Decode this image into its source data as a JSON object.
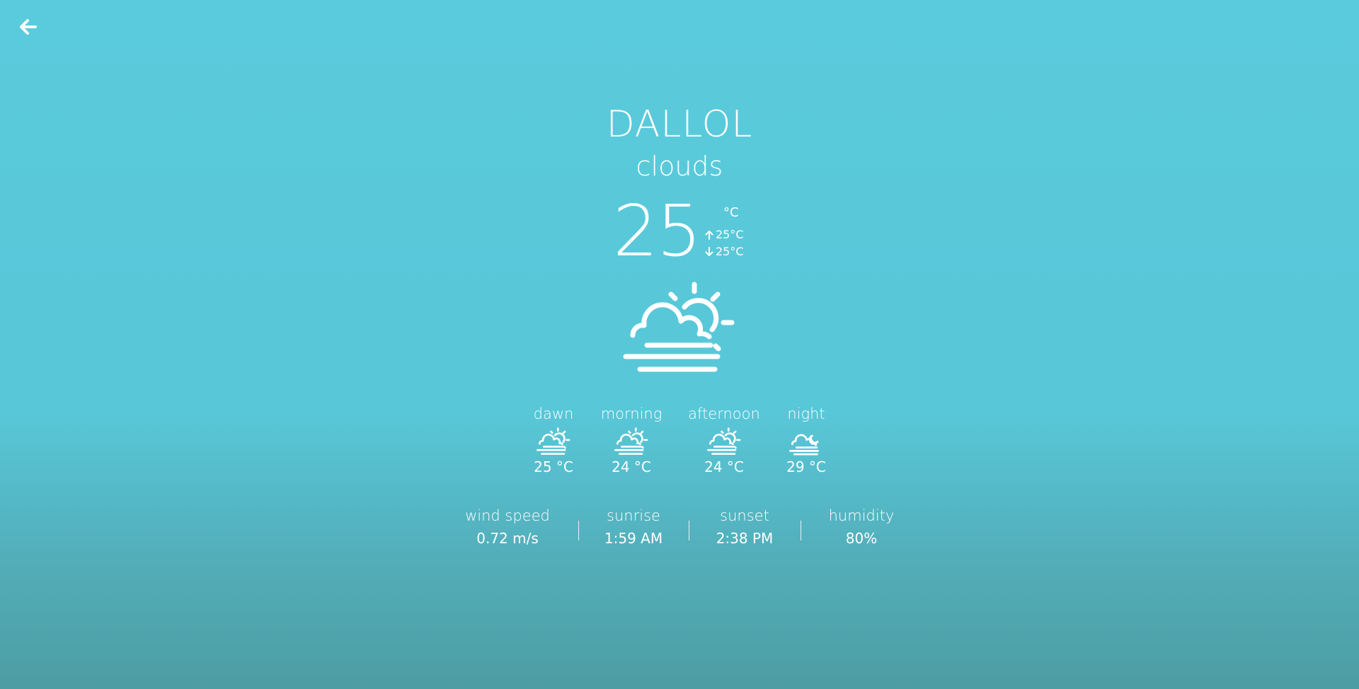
{
  "nav": {
    "back_icon": "arrow-left-icon"
  },
  "weather": {
    "city": "DALLOL",
    "condition": "clouds",
    "temperature": "25",
    "unit": "°C",
    "max": "25°C",
    "min": "25°C",
    "icon": "cloud-sun-fog-icon"
  },
  "periods": [
    {
      "label": "dawn",
      "temp": "25 °C",
      "icon": "cloud-sun-fog-icon"
    },
    {
      "label": "morning",
      "temp": "24 °C",
      "icon": "cloud-sun-fog-icon"
    },
    {
      "label": "afternoon",
      "temp": "24 °C",
      "icon": "cloud-sun-fog-icon"
    },
    {
      "label": "night",
      "temp": "29 °C",
      "icon": "cloud-moon-fog-icon"
    }
  ],
  "stats": [
    {
      "label": "wind speed",
      "value": "0.72 m/s"
    },
    {
      "label": "sunrise",
      "value": "1:59 AM"
    },
    {
      "label": "sunset",
      "value": "2:38 PM"
    },
    {
      "label": "humidity",
      "value": "80%"
    }
  ],
  "colors": {
    "text": "#ffffff",
    "background_top": "#5acbdc",
    "background_bottom": "#4d9da3"
  }
}
